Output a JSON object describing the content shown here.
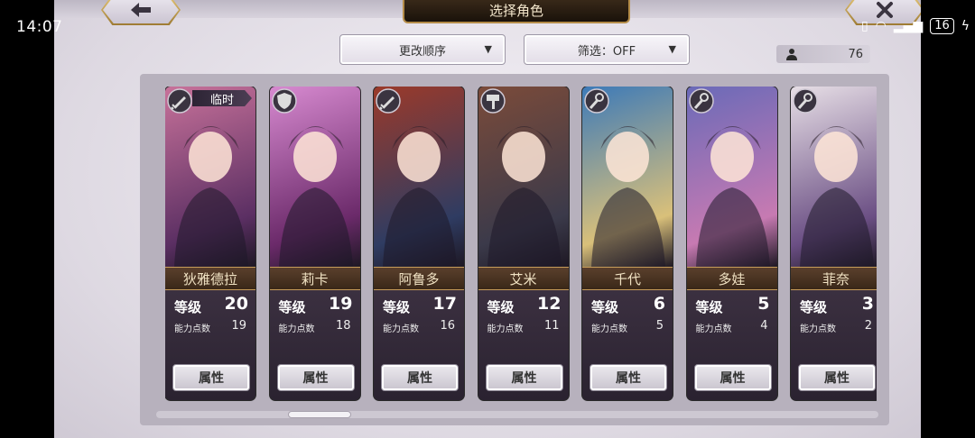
{
  "status_bar": {
    "time": "14:07",
    "battery": "16"
  },
  "header": {
    "title": "选择角色",
    "back_icon": "arrow-left-icon",
    "close_icon": "close-icon"
  },
  "controls": {
    "order_label": "更改顺序",
    "filter_label": "筛选：OFF",
    "character_count": "76"
  },
  "labels": {
    "level": "等级",
    "ability_points": "能力点数",
    "attributes": "属性",
    "temporary": "临时"
  },
  "characters": [
    {
      "name": "狄雅德拉",
      "level": "20",
      "ability_points": "19",
      "class_icon": "sword-icon",
      "temporary": true,
      "colors": [
        "#c8729a",
        "#5b2f63"
      ]
    },
    {
      "name": "莉卡",
      "level": "19",
      "ability_points": "18",
      "class_icon": "shield-icon",
      "temporary": false,
      "colors": [
        "#d78ad0",
        "#6b2a6a"
      ]
    },
    {
      "name": "阿鲁多",
      "level": "17",
      "ability_points": "16",
      "class_icon": "sword-icon",
      "temporary": false,
      "colors": [
        "#9b3a2a",
        "#2f3c62"
      ]
    },
    {
      "name": "艾米",
      "level": "12",
      "ability_points": "11",
      "class_icon": "hammer-icon",
      "temporary": false,
      "colors": [
        "#7b4b3a",
        "#3b3a4a"
      ]
    },
    {
      "name": "千代",
      "level": "6",
      "ability_points": "5",
      "class_icon": "staff-icon",
      "temporary": false,
      "colors": [
        "#3d7ab8",
        "#d9c07a"
      ]
    },
    {
      "name": "多娃",
      "level": "5",
      "ability_points": "4",
      "class_icon": "staff-icon",
      "temporary": false,
      "colors": [
        "#6a6ab8",
        "#c77ab2"
      ]
    },
    {
      "name": "菲奈",
      "level": "3",
      "ability_points": "2",
      "class_icon": "staff-icon",
      "temporary": false,
      "colors": [
        "#e7dfe6",
        "#6b4f84"
      ]
    }
  ]
}
